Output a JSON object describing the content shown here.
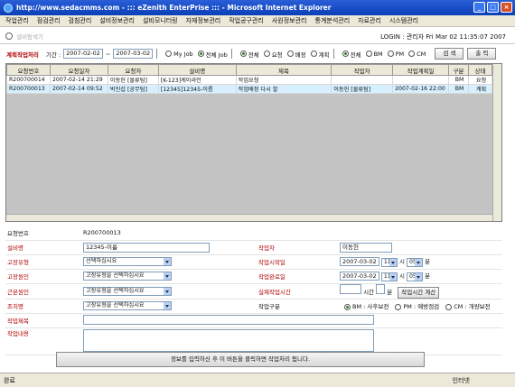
{
  "window": {
    "title": "http://www.sedacmms.com - ::: eZenith EnterPrise ::: - Microsoft Internet Explorer"
  },
  "menu": [
    "작업관리",
    "점검관리",
    "검침관리",
    "설비정보관리",
    "설비모니터링",
    "자재정보관리",
    "작업공구관리",
    "사원정보관리",
    "통계분석관리",
    "자료관리",
    "시스템관리"
  ],
  "search": {
    "placeholder": "설비탐색기"
  },
  "login": {
    "text": "LOGIN : 관리자    Fri Mar 02 11:35:07 2007"
  },
  "filter": {
    "title": "계획작업처리",
    "period_label": "기간 :",
    "from": "2007-02-02",
    "to": "2007-03-02",
    "tilde": "~",
    "job_options": [
      "My Job",
      "전체 Job"
    ],
    "status_options": [
      "전체",
      "요청",
      "배정",
      "계획"
    ],
    "type_options": [
      "전체",
      "BM",
      "PM",
      "CM"
    ],
    "search_btn": "검 색",
    "print_btn": "출 력"
  },
  "grid": {
    "columns": [
      "요청번호",
      "요청일자",
      "요청자",
      "설비명",
      "제목",
      "작업자",
      "작업계획일",
      "구분",
      "상태"
    ],
    "rows": [
      [
        "R200700014",
        "2007-02-14 21:29",
        "이동헌 [물류팀]",
        "[K-123]케이라인",
        "작업요청",
        "",
        "",
        "BM",
        "요청"
      ],
      [
        "R200700013",
        "2007-02-14 09:52",
        "박진섭 [공무팀]",
        "[12345]12345-이름",
        "작업배정 다시 할",
        "이동헌 [물류팀]",
        "2007-02-16 22:00",
        "BM",
        "계획"
      ]
    ]
  },
  "form": {
    "req_no_label": "요청번호",
    "req_no_value": "R200700013",
    "equip_label": "설비명",
    "equip_value": "12345-이름",
    "worker_label": "작업자",
    "worker_value": "이동헌",
    "fault_type_label": "고장유형",
    "fault_type_value": "선택하십시요",
    "start_label": "작업시작일",
    "start_date": "2007-03-02",
    "start_hour": "11",
    "start_min": "05",
    "hour_unit": "시",
    "min_unit": "분",
    "fault_cause_label": "고장원인",
    "fault_cause_value": "고장유형을 선택하십시요",
    "end_label": "작업완료일",
    "end_date": "2007-03-02",
    "end_hour": "11",
    "end_min": "05",
    "root_cause_label": "근본원인",
    "root_cause_value": "고장유형을 선택하십시요",
    "actual_label": "실제작업시간",
    "actual_hour_unit": "시간",
    "actual_min_unit": "분",
    "calc_btn": "작업시간 계산",
    "action_label": "조치명",
    "action_value": "고장유형을 선택하십시요",
    "work_type_label": "작업구분",
    "work_types": [
      "BM : 사후보전",
      "PM : 예방점검",
      "CM : 개량보전"
    ],
    "title_label": "작업제목",
    "content_label": "작업내용"
  },
  "submit": {
    "text": "정보를 입력하신 후 이 버튼을 클릭하면 작업처리 됩니다."
  },
  "status": {
    "left": "완료",
    "zone": "인터넷"
  }
}
